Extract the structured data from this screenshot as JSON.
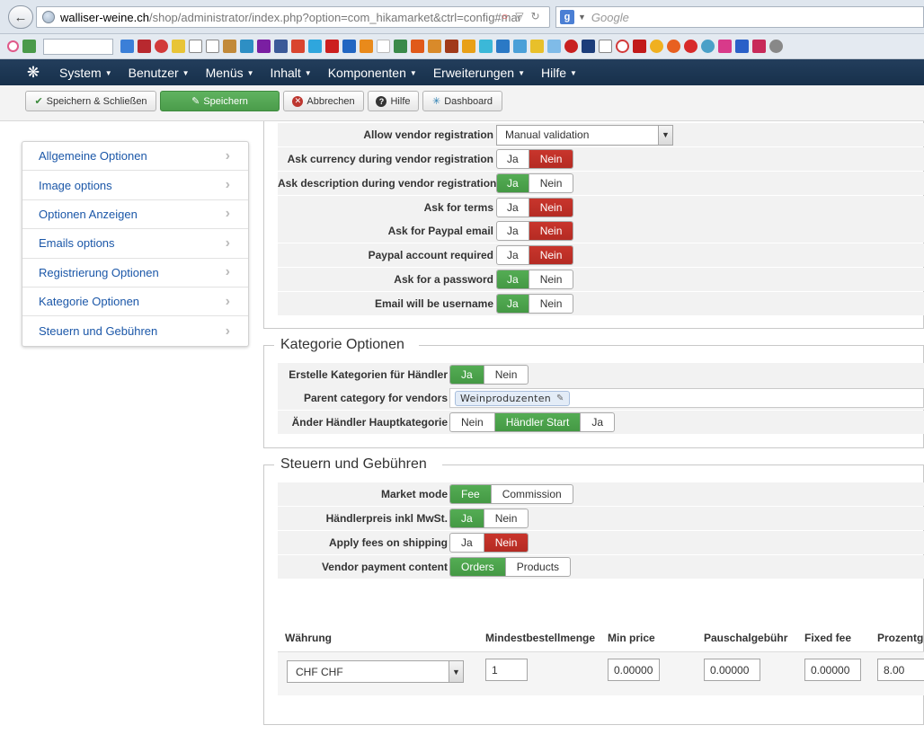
{
  "browser": {
    "url_host": "walliser-weine.ch",
    "url_path": "/shop/administrator/index.php?option=com_hikamarket&ctrl=config#mar",
    "search_placeholder": "Google"
  },
  "nav": {
    "items": [
      "System",
      "Benutzer",
      "Menüs",
      "Inhalt",
      "Komponenten",
      "Erweiterungen",
      "Hilfe"
    ]
  },
  "toolbar": {
    "save_close": "Speichern & Schließen",
    "save": "Speichern",
    "cancel": "Abbrechen",
    "help": "Hilfe",
    "dashboard": "Dashboard"
  },
  "sidebar": {
    "items": [
      {
        "label": "Allgemeine Optionen"
      },
      {
        "label": "Image options"
      },
      {
        "label": "Optionen Anzeigen"
      },
      {
        "label": "Emails options"
      },
      {
        "label": "Registrierung Optionen"
      },
      {
        "label": "Kategorie Optionen"
      },
      {
        "label": "Steuern und Gebühren"
      }
    ]
  },
  "registration": {
    "allow_vendor_label": "Allow vendor registration",
    "allow_vendor_value": "Manual validation",
    "rows": [
      {
        "label": "Ask currency during vendor registration",
        "yes": "Ja",
        "no": "Nein",
        "selected": "no"
      },
      {
        "label": "Ask description during vendor registration",
        "yes": "Ja",
        "no": "Nein",
        "selected": "yes"
      },
      {
        "label": "Ask for terms",
        "yes": "Ja",
        "no": "Nein",
        "selected": "no"
      },
      {
        "label": "Ask for Paypal email",
        "yes": "Ja",
        "no": "Nein",
        "selected": "no"
      },
      {
        "label": "Paypal account required",
        "yes": "Ja",
        "no": "Nein",
        "selected": "no"
      },
      {
        "label": "Ask for a password",
        "yes": "Ja",
        "no": "Nein",
        "selected": "yes"
      },
      {
        "label": "Email will be username",
        "yes": "Ja",
        "no": "Nein",
        "selected": "yes"
      }
    ]
  },
  "category": {
    "legend": "Kategorie Optionen",
    "create_label": "Erstelle Kategorien für Händler",
    "create_yes": "Ja",
    "create_no": "Nein",
    "parent_label": "Parent category for vendors",
    "parent_tag": "Weinproduzenten",
    "main_label": "Änder Händler Hauptkategorie",
    "main_opt1": "Nein",
    "main_opt2": "Händler Start",
    "main_opt3": "Ja"
  },
  "taxes": {
    "legend": "Steuern und Gebühren",
    "market_mode_label": "Market mode",
    "market_fee": "Fee",
    "market_commission": "Commission",
    "vendor_price_label": "Händlerpreis inkl MwSt.",
    "vendor_price_yes": "Ja",
    "vendor_price_no": "Nein",
    "fees_shipping_label": "Apply fees on shipping",
    "fees_shipping_yes": "Ja",
    "fees_shipping_no": "Nein",
    "payment_content_label": "Vendor payment content",
    "payment_orders": "Orders",
    "payment_products": "Products"
  },
  "currency_table": {
    "headers": [
      "Währung",
      "Mindestbestellmenge",
      "Min price",
      "Pauschalgebühr",
      "Fixed fee",
      "Prozentg"
    ],
    "currency": "CHF CHF",
    "min_qty": "1",
    "min_price": "0.00000",
    "flat_fee": "0.00000",
    "fixed_fee": "0.00000",
    "percent": "8.00"
  }
}
